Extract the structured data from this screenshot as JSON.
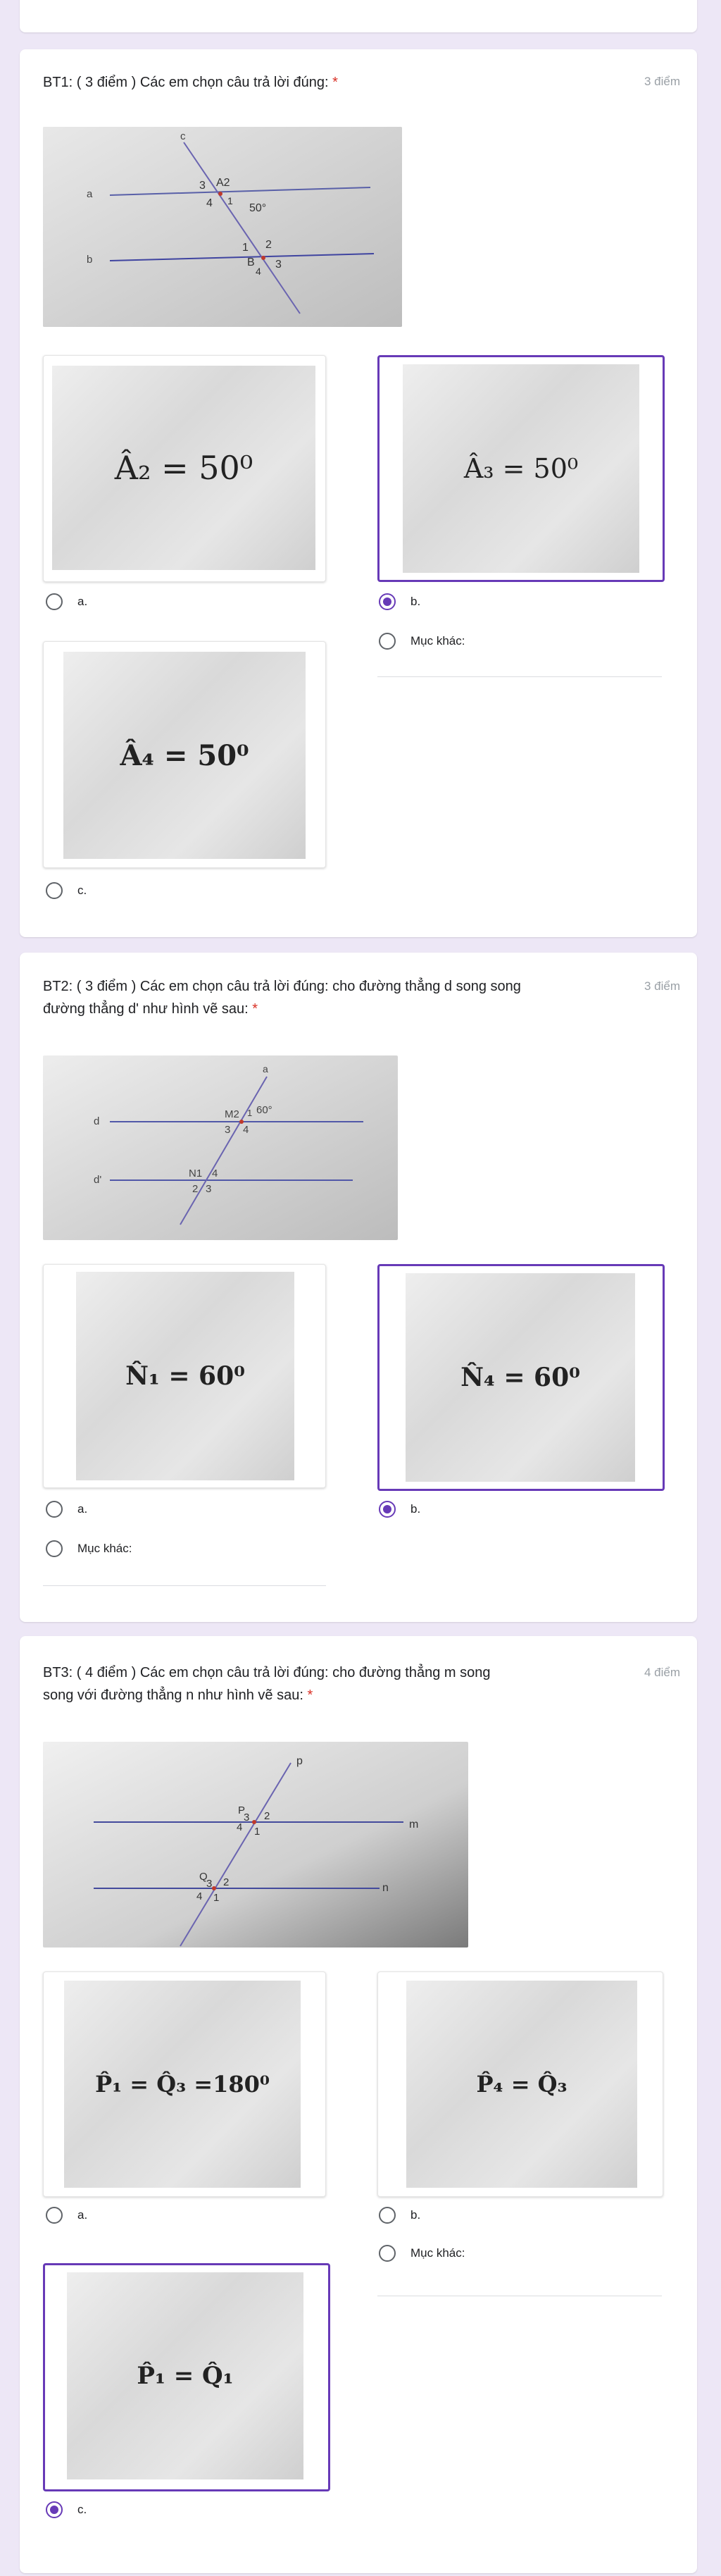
{
  "required_mark": "*",
  "other_label": "Mục khác:",
  "q1": {
    "title": "BT1: ( 3 điểm ) Các em chọn câu trả lời đúng:",
    "points": "3 điểm",
    "diagram_labels": {
      "line_c": "c",
      "line_a": "a",
      "line_b": "b",
      "a3": "3",
      "a2": "A2",
      "a4": "4",
      "a1": "1",
      "angle": "50°",
      "b1": "1",
      "b2": "2",
      "b_letter": "B",
      "b4": "4",
      "b3": "3"
    },
    "options": [
      {
        "letter": "a.",
        "formula": "Â₂ = 50⁰",
        "selected": false
      },
      {
        "letter": "b.",
        "formula": "Â₃ = 50⁰",
        "selected": true
      },
      {
        "letter": "c.",
        "formula": "Â₄ = 50⁰",
        "selected": false
      }
    ]
  },
  "q2": {
    "title_line1": "BT2: ( 3 điểm ) Các em chọn câu trả lời đúng: cho đường thẳng d song song",
    "title_line2": "đường thẳng d' như hình vẽ sau:",
    "points": "3 điểm",
    "diagram_labels": {
      "line_a": "a",
      "line_d": "d",
      "line_d2": "d'",
      "m_label": "M2",
      "m1": "1",
      "angle": "60°",
      "m3": "3",
      "m4": "4",
      "n_label": "N1",
      "n4": "4",
      "n2": "2",
      "n3": "3"
    },
    "options": [
      {
        "letter": "a.",
        "formula": "N̂₁ = 60⁰",
        "selected": false
      },
      {
        "letter": "b.",
        "formula": "N̂₄ = 60⁰",
        "selected": true
      }
    ]
  },
  "q3": {
    "title_line1": "BT3: ( 4 điểm ) Các em chọn câu trả lời đúng: cho đường thẳng m song",
    "title_line2": "song với đường thẳng n như hình vẽ sau:",
    "points": "4 điểm",
    "diagram_labels": {
      "line_p": "p",
      "line_m": "m",
      "line_n": "n",
      "p_label": "P",
      "p3": "3",
      "p2": "2",
      "p4": "4",
      "p1": "1",
      "q_label": "Q",
      "q3": "3",
      "q2": "2",
      "q4": "4",
      "q1": "1"
    },
    "options": [
      {
        "letter": "a.",
        "formula": "P̂₁ = Q̂₃ =180⁰",
        "selected": false
      },
      {
        "letter": "b.",
        "formula": "P̂₄ = Q̂₃",
        "selected": false
      },
      {
        "letter": "c.",
        "formula": "P̂₁ = Q̂₁",
        "selected": true
      }
    ]
  }
}
